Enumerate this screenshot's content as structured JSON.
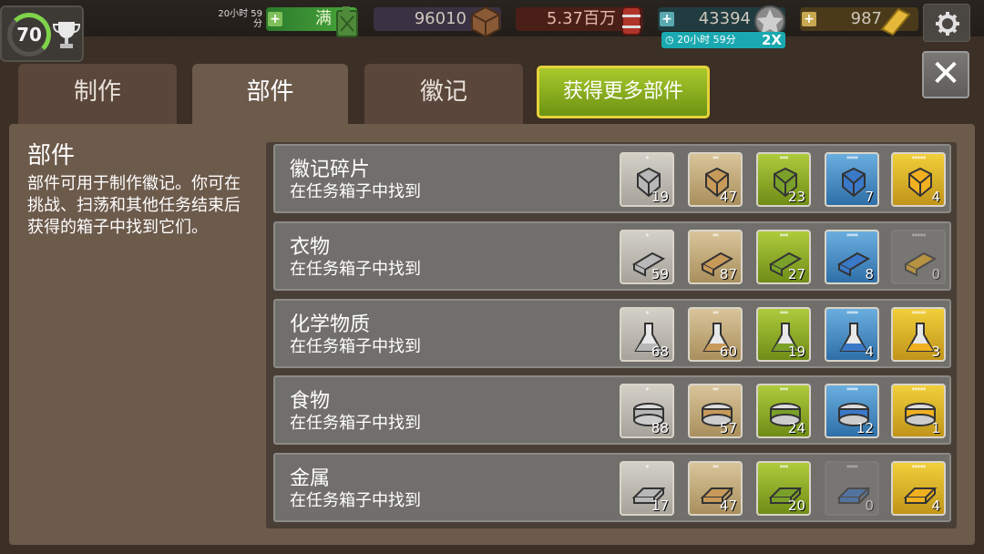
{
  "level": {
    "value": "70"
  },
  "resources": {
    "energy_timer": "20小时 59分",
    "energy_text": "满",
    "wood": "96010",
    "fuel": "5.37百万",
    "xp": "43394",
    "boost_timer": "20小时 59分",
    "boost_multiplier": "2X",
    "gold": "987"
  },
  "tabs": [
    {
      "label": "制作"
    },
    {
      "label": "部件"
    },
    {
      "label": "徽记"
    }
  ],
  "get_more_label": "获得更多部件",
  "sidebar": {
    "title": "部件",
    "description": "部件可用于制作徽记。你可在挑战、扫荡和其他任务结束后获得的箱子中找到它们。"
  },
  "rows": [
    {
      "name": "徽记碎片",
      "sub": "在任务箱子中找到",
      "counts": [
        "19",
        "47",
        "23",
        "7",
        "4"
      ]
    },
    {
      "name": "衣物",
      "sub": "在任务箱子中找到",
      "counts": [
        "59",
        "87",
        "27",
        "8",
        "0"
      ]
    },
    {
      "name": "化学物质",
      "sub": "在任务箱子中找到",
      "counts": [
        "68",
        "60",
        "19",
        "4",
        "3"
      ]
    },
    {
      "name": "食物",
      "sub": "在任务箱子中找到",
      "counts": [
        "88",
        "57",
        "24",
        "12",
        "1"
      ]
    },
    {
      "name": "金属",
      "sub": "在任务箱子中找到",
      "counts": [
        "17",
        "47",
        "20",
        "0",
        "4"
      ]
    }
  ],
  "stars": [
    "*",
    "**",
    "***",
    "****",
    "*****"
  ]
}
